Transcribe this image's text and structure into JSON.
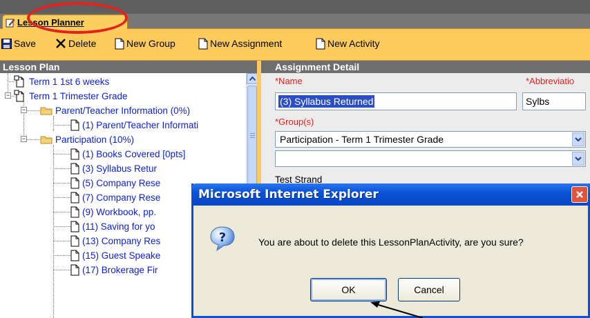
{
  "tab": {
    "label": "Lesson Planner",
    "icon": "pencil-note-icon"
  },
  "toolbar": {
    "save": "Save",
    "delete": "Delete",
    "new_group": "New Group",
    "new_assignment": "New Assignment",
    "new_activity": "New Activity"
  },
  "left_panel": {
    "header": "Lesson Plan",
    "tree": [
      {
        "label": "Term 1 1st 6 weeks",
        "icon": "term-icon"
      },
      {
        "label": "Term 1 Trimester Grade",
        "icon": "term-icon"
      },
      {
        "label": "Parent/Teacher Information (0%)",
        "icon": "folder-icon"
      },
      {
        "label": "(1) Parent/Teacher Informati",
        "icon": "document-icon"
      },
      {
        "label": "Participation (10%)",
        "icon": "folder-icon"
      },
      {
        "label": "(1) Books Covered [0pts]",
        "icon": "document-icon"
      },
      {
        "label": "(3) Syllabus Retur",
        "icon": "document-icon"
      },
      {
        "label": "(5) Company Rese",
        "icon": "document-icon"
      },
      {
        "label": "(7) Company Rese",
        "icon": "document-icon"
      },
      {
        "label": "(9) Workbook, pp.",
        "icon": "document-icon"
      },
      {
        "label": "(11) Saving for yo",
        "icon": "document-icon"
      },
      {
        "label": "(13) Company Res",
        "icon": "document-icon"
      },
      {
        "label": "(15) Guest Speake",
        "icon": "document-icon"
      },
      {
        "label": "(17) Brokerage Fir",
        "icon": "document-icon"
      }
    ]
  },
  "right_panel": {
    "header": "Assignment Detail",
    "name_label": "*Name",
    "name_value": "(3) Syllabus Returned",
    "abbrev_label": "*Abbreviatio",
    "abbrev_value": "Sylbs",
    "groups_label": "*Group(s)",
    "group1_value": "Participation - Term 1 Trimester Grade",
    "group2_value": "",
    "strand_label": "Test Strand"
  },
  "dialog": {
    "title": "Microsoft Internet Explorer",
    "message": "You are about to delete this LessonPlanActivity, are you sure?",
    "ok": "OK",
    "cancel": "Cancel",
    "icon": "question-icon"
  },
  "colors": {
    "toolbar_bg": "#fdca5c",
    "header_bg": "#6e6e6e",
    "tree_link": "#0c1fd0",
    "required_label": "#e02020",
    "annotation": "#e5201d",
    "dialog_title": "#0a52d8"
  }
}
